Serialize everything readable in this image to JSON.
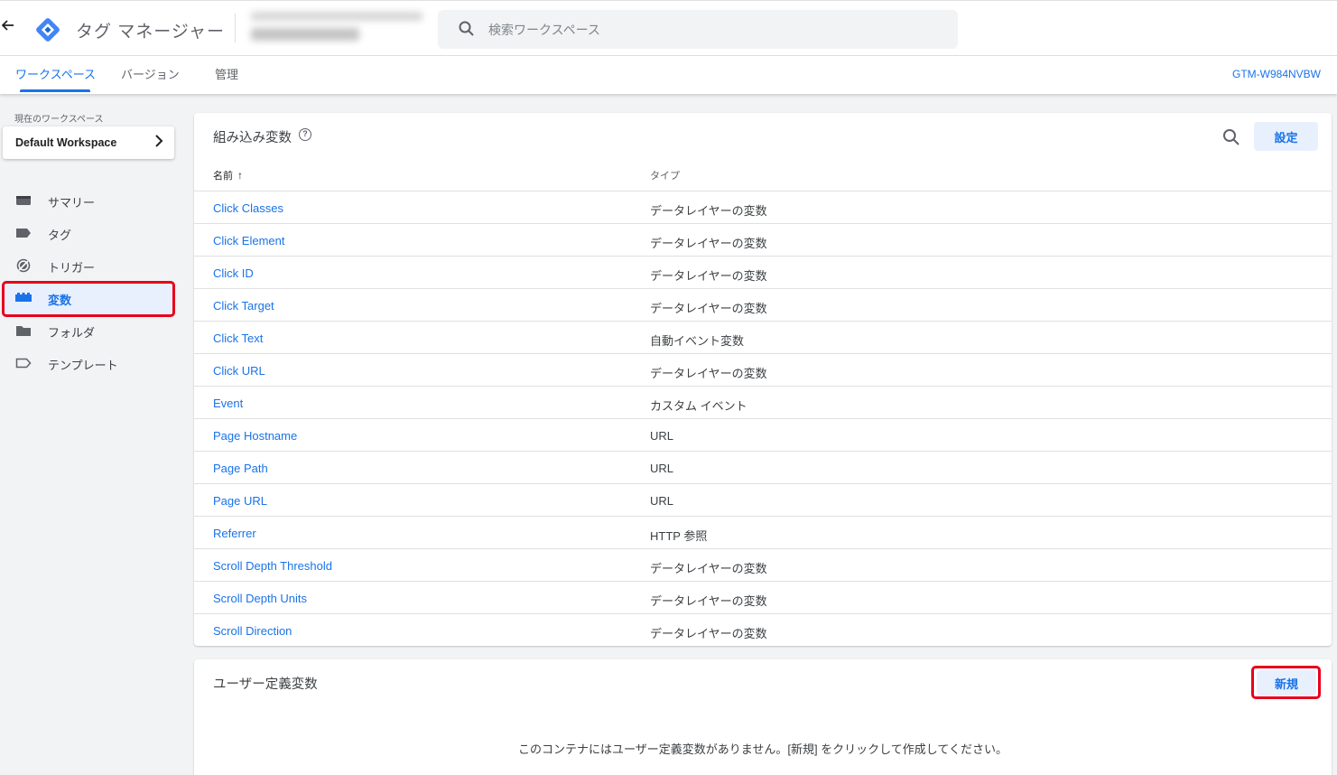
{
  "header": {
    "app_title": "タグ マネージャー",
    "search_placeholder": "検索ワークスペース",
    "brand_color": "#4285f4"
  },
  "tabs": [
    {
      "label": "ワークスペース",
      "active": true
    },
    {
      "label": "バージョン",
      "active": false
    },
    {
      "label": "管理",
      "active": false
    }
  ],
  "container_id": "GTM-W984NVBW",
  "sidebar": {
    "workspace_label": "現在のワークスペース",
    "workspace_name": "Default Workspace",
    "items": [
      {
        "label": "サマリー",
        "icon": "summary-icon"
      },
      {
        "label": "タグ",
        "icon": "tag-icon"
      },
      {
        "label": "トリガー",
        "icon": "trigger-icon"
      },
      {
        "label": "変数",
        "icon": "variables-icon",
        "active": true
      },
      {
        "label": "フォルダ",
        "icon": "folder-icon"
      },
      {
        "label": "テンプレート",
        "icon": "template-icon"
      }
    ]
  },
  "builtin": {
    "title": "組み込み変数",
    "settings_label": "設定",
    "col_name": "名前",
    "col_type": "タイプ",
    "rows": [
      {
        "name": "Click Classes",
        "type": "データレイヤーの変数"
      },
      {
        "name": "Click Element",
        "type": "データレイヤーの変数"
      },
      {
        "name": "Click ID",
        "type": "データレイヤーの変数"
      },
      {
        "name": "Click Target",
        "type": "データレイヤーの変数"
      },
      {
        "name": "Click Text",
        "type": "自動イベント変数"
      },
      {
        "name": "Click URL",
        "type": "データレイヤーの変数"
      },
      {
        "name": "Event",
        "type": "カスタム イベント"
      },
      {
        "name": "Page Hostname",
        "type": "URL"
      },
      {
        "name": "Page Path",
        "type": "URL"
      },
      {
        "name": "Page URL",
        "type": "URL"
      },
      {
        "name": "Referrer",
        "type": "HTTP 参照"
      },
      {
        "name": "Scroll Depth Threshold",
        "type": "データレイヤーの変数"
      },
      {
        "name": "Scroll Depth Units",
        "type": "データレイヤーの変数"
      },
      {
        "name": "Scroll Direction",
        "type": "データレイヤーの変数"
      }
    ]
  },
  "user_defined": {
    "title": "ユーザー定義変数",
    "new_label": "新規",
    "empty_message": "このコンテナにはユーザー定義変数がありません。[新規] をクリックして作成してください。"
  },
  "colors": {
    "accent": "#1a73e8",
    "highlight": "#e8001a"
  }
}
